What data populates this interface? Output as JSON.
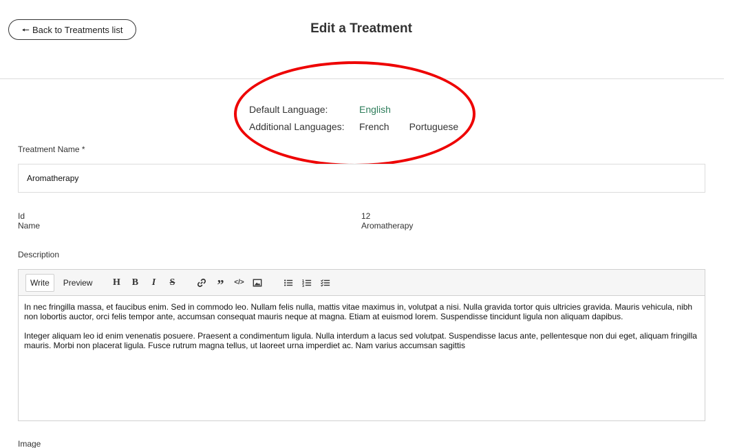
{
  "header": {
    "back_label": "Back to Treatments list",
    "title": "Edit a Treatment"
  },
  "languages": {
    "default_label": "Default Language:",
    "default_value": "English",
    "additional_label": "Additional Languages:",
    "additional": [
      "French",
      "Portuguese"
    ],
    "default_color": "#2e7d5b"
  },
  "form": {
    "treatment_name_label": "Treatment Name *",
    "treatment_name_value": "Aromatherapy",
    "info": {
      "id_label": "Id",
      "id_value": "12",
      "name_label": "Name",
      "name_value": "Aromatherapy"
    },
    "description_label": "Description",
    "image_label": "Image"
  },
  "editor": {
    "tabs": [
      "Write",
      "Preview"
    ],
    "active_tab": "Write",
    "toolbar_icons": [
      "heading-icon",
      "bold-icon",
      "italic-icon",
      "strikethrough-icon",
      "link-icon",
      "quote-icon",
      "code-icon",
      "image-icon",
      "bulleted-list-icon",
      "numbered-list-icon",
      "task-list-icon"
    ],
    "paragraphs": [
      "In nec fringilla massa, et faucibus enim. Sed in commodo leo. Nullam felis nulla, mattis vitae maximus in, volutpat a nisi. Nulla gravida tortor quis ultricies gravida. Mauris vehicula, nibh non lobortis auctor, orci felis tempor ante, accumsan consequat mauris neque at magna. Etiam at euismod lorem. Suspendisse tincidunt ligula non aliquam dapibus.",
      "Integer aliquam leo id enim venenatis posuere. Praesent a condimentum ligula. Nulla interdum a lacus sed volutpat. Suspendisse lacus ante, pellentesque non dui eget, aliquam fringilla mauris. Morbi non placerat ligula. Fusce rutrum magna tellus, ut laoreet urna imperdiet ac. Nam varius accumsan sagittis"
    ]
  },
  "annotation": {
    "highlight_color": "#ee0000"
  }
}
